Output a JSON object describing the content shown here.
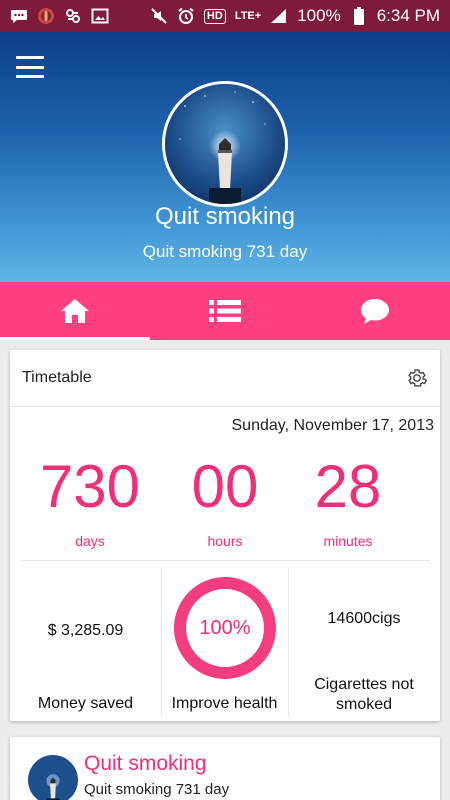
{
  "status_bar": {
    "battery": "100%",
    "time": "6:34 PM",
    "hd_label": "HD",
    "network_label": "LTE+",
    "icons": [
      "messages-icon",
      "app-notification-icon",
      "sync-icon",
      "gallery-icon",
      "mute-icon",
      "alarm-icon",
      "hd-icon",
      "lte-icon",
      "signal-icon",
      "battery-icon"
    ]
  },
  "header": {
    "title": "Quit smoking",
    "subtitle": "Quit smoking 731 day",
    "menu_icon": "hamburger-menu-icon",
    "avatar_image": "lighthouse-night-sky"
  },
  "tabs": [
    {
      "icon": "home-icon",
      "active": true
    },
    {
      "icon": "list-icon",
      "active": false
    },
    {
      "icon": "chat-bubble-icon",
      "active": false
    }
  ],
  "timetable": {
    "title": "Timetable",
    "settings_icon": "gear-icon",
    "date": "Sunday, November 17, 2013",
    "days": {
      "value": "730",
      "label": "days"
    },
    "hours": {
      "value": "00",
      "label": "hours"
    },
    "minutes": {
      "value": "28",
      "label": "minutes"
    },
    "money": {
      "value": "$  3,285.09",
      "label": "Money saved"
    },
    "health": {
      "value": "100%",
      "label": "Improve health",
      "progress": 1.0
    },
    "cigs": {
      "value": "14600cigs",
      "label_line1": "Cigarettes not",
      "label_line2": "smoked"
    }
  },
  "feed_item": {
    "title": "Quit smoking",
    "subtitle": "Quit smoking 731 day"
  },
  "colors": {
    "accent": "#ff3f80",
    "accent_text": "#f02e79",
    "status_bar": "#7e1b3a",
    "hero_top": "#0b3f86",
    "hero_bottom": "#5fb6e6"
  }
}
